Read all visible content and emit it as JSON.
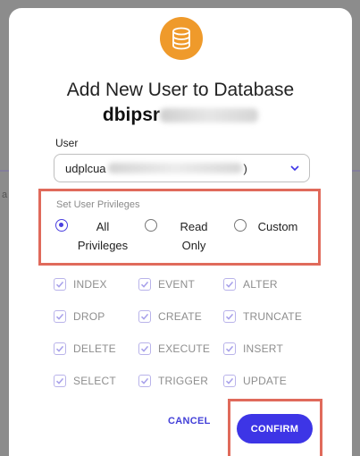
{
  "background": {
    "left_text_1": "a",
    "left_text_2": "a"
  },
  "modal": {
    "icon": "database-icon",
    "title": "Add New User to Database",
    "db_name_prefix": "dbipsr",
    "user_label": "User",
    "user_value_prefix": "udplcua",
    "user_value_suffix": ")",
    "privileges_title": "Set User Privileges",
    "radio_options": [
      {
        "line1": "All",
        "line2": "Privileges",
        "selected": true
      },
      {
        "line1": "Read",
        "line2": "Only",
        "selected": false
      },
      {
        "line1": "Custom",
        "line2": "",
        "selected": false
      }
    ],
    "checkboxes": [
      "INDEX",
      "EVENT",
      "ALTER",
      "DROP",
      "CREATE",
      "TRUNCATE",
      "DELETE",
      "EXECUTE",
      "INSERT",
      "SELECT",
      "TRIGGER",
      "UPDATE"
    ],
    "cancel_label": "CANCEL",
    "confirm_label": "CONFIRM"
  },
  "colors": {
    "accent": "#3d35e6",
    "highlight": "#e06a5b",
    "logo": "#ef9a2b"
  }
}
